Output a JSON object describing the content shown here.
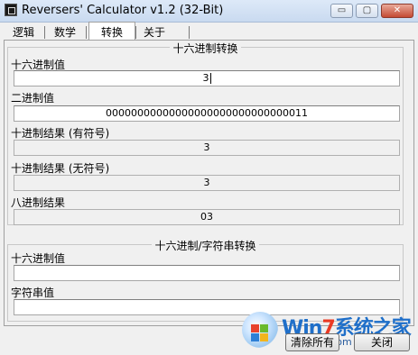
{
  "window": {
    "title": "Reversers' Calculator v1.2 (32-Bit)",
    "icon": "app-icon",
    "controls": {
      "minimize": "▭",
      "maximize": "▢",
      "close": "✕"
    }
  },
  "tabs": [
    {
      "label": "逻辑",
      "active": false
    },
    {
      "label": "数学",
      "active": false
    },
    {
      "label": "转换",
      "active": true
    },
    {
      "label": "关于",
      "active": false
    }
  ],
  "conversion": {
    "title": "十六进制转换",
    "hex_label": "十六进制值",
    "hex_value": "3",
    "binary_label": "二进制值",
    "binary_value": "00000000000000000000000000000011",
    "dec_signed_label": "十进制结果 (有符号)",
    "dec_signed_value": "3",
    "dec_unsigned_label": "十进制结果 (无符号)",
    "dec_unsigned_value": "3",
    "octal_label": "八进制结果",
    "octal_value": "03"
  },
  "string_conversion": {
    "title": "十六进制/字符串转换",
    "hex_label": "十六进制值",
    "hex_value": "",
    "string_label": "字符串值",
    "string_value": ""
  },
  "buttons": {
    "clear_all": "清除所有",
    "close": "关闭"
  },
  "watermark": {
    "text_a": "Win",
    "text_b": "7",
    "text_c": "系统之家",
    "url": "Winwin7.com"
  },
  "colors": {
    "title_bar": "#c9daf0",
    "close_button": "#c44a33",
    "watermark_blue": "#1f6fc9"
  }
}
